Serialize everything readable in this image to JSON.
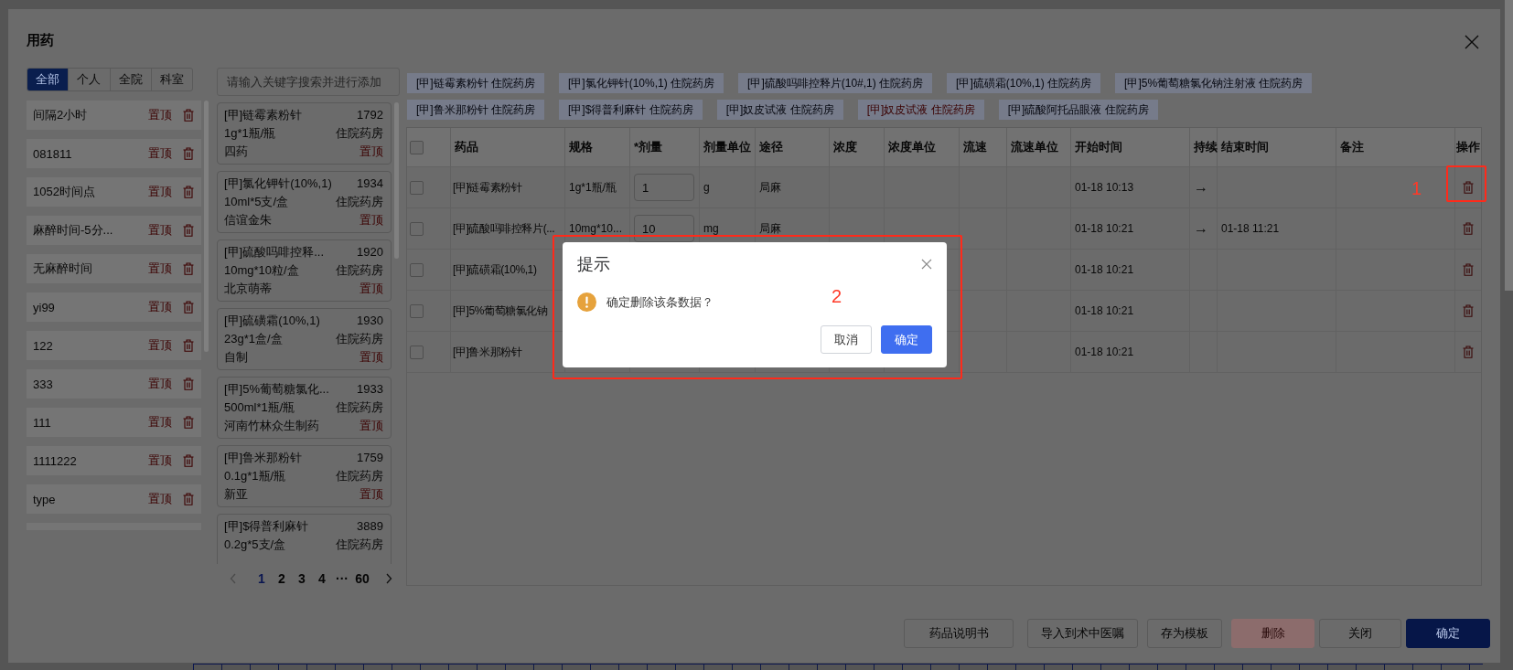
{
  "dialog": {
    "title": "用药"
  },
  "scope_tabs": [
    {
      "label": "全部",
      "selected": true
    },
    {
      "label": "个人",
      "selected": false
    },
    {
      "label": "全院",
      "selected": false
    },
    {
      "label": "科室",
      "selected": false
    }
  ],
  "templates": [
    {
      "name": "间隔2小时",
      "pin": "置顶"
    },
    {
      "name": "081811",
      "pin": "置顶"
    },
    {
      "name": "1052时间点",
      "pin": "置顶"
    },
    {
      "name": "麻醉时间-5分...",
      "pin": "置顶"
    },
    {
      "name": "无麻醉时间",
      "pin": "置顶"
    },
    {
      "name": "yi99",
      "pin": "置顶"
    },
    {
      "name": "122",
      "pin": "置顶"
    },
    {
      "name": "333",
      "pin": "置顶"
    },
    {
      "name": "111",
      "pin": "置顶"
    },
    {
      "name": "1111222",
      "pin": "置顶"
    },
    {
      "name": "type",
      "pin": "置顶"
    }
  ],
  "search": {
    "placeholder": "请输入关键字搜索并进行添加"
  },
  "drugs": [
    {
      "name": "[甲]链霉素粉针",
      "code": "1792",
      "spec": "1g*1瓶/瓶",
      "pharmacy": "住院药房",
      "maker": "四药",
      "pin": "置顶"
    },
    {
      "name": "[甲]氯化钾针(10%,1)",
      "code": "1934",
      "spec": "10ml*5支/盒",
      "pharmacy": "住院药房",
      "maker": "信谊金朱",
      "pin": "置顶"
    },
    {
      "name": "[甲]硫酸吗啡控释...",
      "code": "1920",
      "spec": "10mg*10粒/盒",
      "pharmacy": "住院药房",
      "maker": "北京萌蒂",
      "pin": "置顶"
    },
    {
      "name": "[甲]硫磺霜(10%,1)",
      "code": "1930",
      "spec": "23g*1盒/盒",
      "pharmacy": "住院药房",
      "maker": "自制",
      "pin": "置顶"
    },
    {
      "name": "[甲]5%葡萄糖氯化...",
      "code": "1933",
      "spec": "500ml*1瓶/瓶",
      "pharmacy": "住院药房",
      "maker": "河南竹林众生制药",
      "pin": "置顶"
    },
    {
      "name": "[甲]鲁米那粉针",
      "code": "1759",
      "spec": "0.1g*1瓶/瓶",
      "pharmacy": "住院药房",
      "maker": "新亚",
      "pin": "置顶"
    },
    {
      "name": "[甲]$得普利麻针",
      "code": "3889",
      "spec": "0.2g*5支/盒",
      "pharmacy": "住院药房"
    }
  ],
  "pagination": [
    {
      "label": "1",
      "selected": true
    },
    {
      "label": "2",
      "selected": false
    },
    {
      "label": "3",
      "selected": false
    },
    {
      "label": "4",
      "selected": false
    },
    {
      "label": "···",
      "selected": false
    },
    {
      "label": "60",
      "selected": false
    }
  ],
  "tag_rows": [
    {
      "tags": [
        {
          "label": "[甲]链霉素粉针 住院药房",
          "alert": false
        },
        {
          "label": "[甲]氯化钾针(10%,1) 住院药房",
          "alert": false
        },
        {
          "label": "[甲]硫酸吗啡控释片(10#,1) 住院药房",
          "alert": false
        },
        {
          "label": "[甲]硫磺霜(10%,1) 住院药房",
          "alert": false
        },
        {
          "label": "[甲]5%葡萄糖氯化钠注射液 住院药房",
          "alert": false
        }
      ]
    },
    {
      "tags": [
        {
          "label": "[甲]鲁米那粉针 住院药房",
          "alert": false
        },
        {
          "label": "[甲]$得普利麻针 住院药房",
          "alert": false
        },
        {
          "label": "[甲]奴皮试液 住院药房",
          "alert": false
        },
        {
          "label": "[甲]奴皮试液 住院药房",
          "alert": true
        },
        {
          "label": "[甲]硫酸阿托品眼液 住院药房",
          "alert": false
        }
      ]
    }
  ],
  "table": {
    "select_all_checked": false,
    "columns": [
      "药品",
      "规格",
      "*剂量",
      "剂量单位",
      "途径",
      "浓度",
      "浓度单位",
      "流速",
      "流速单位",
      "开始时间",
      "持续",
      "结束时间",
      "备注",
      "操作"
    ],
    "rows": [
      {
        "checked": false,
        "drug": "[甲]链霉素粉针",
        "spec": "1g*1瓶/瓶",
        "dose": "1",
        "dose_unit": "g",
        "route": "局麻",
        "start": "01-18 10:13",
        "continuous": "→"
      },
      {
        "checked": false,
        "drug": "[甲]硫酸吗啡控释片(...",
        "spec": "10mg*10...",
        "dose": "10",
        "dose_unit": "mg",
        "route": "局麻",
        "start": "01-18 10:21",
        "continuous": "→",
        "end": "01-18 11:21"
      },
      {
        "checked": false,
        "drug": "[甲]硫磺霜(10%,1)",
        "start": "01-18 10:21"
      },
      {
        "checked": false,
        "drug": "[甲]5%葡萄糖氯化钠",
        "start": "01-18 10:21"
      },
      {
        "checked": false,
        "drug": "[甲]鲁米那粉针",
        "start": "01-18 10:21"
      }
    ]
  },
  "footer_buttons": [
    {
      "label": "药品说明书",
      "kind": "default",
      "disabled": false
    },
    {
      "label": "导入到术中医嘱",
      "kind": "default",
      "disabled": false
    },
    {
      "label": "存为模板",
      "kind": "default",
      "disabled": false
    },
    {
      "label": "删除",
      "kind": "danger",
      "disabled": true
    },
    {
      "label": "关闭",
      "kind": "default",
      "disabled": false
    },
    {
      "label": "确定",
      "kind": "primary",
      "disabled": false
    }
  ],
  "confirm": {
    "title": "提示",
    "message": "确定删除该条数据？",
    "buttons": [
      {
        "label": "取消",
        "kind": "default"
      },
      {
        "label": "确定",
        "kind": "primary"
      }
    ]
  },
  "annotations": [
    {
      "label": "1",
      "kind": "delete-target"
    },
    {
      "label": "2",
      "kind": "dialog-target"
    }
  ]
}
